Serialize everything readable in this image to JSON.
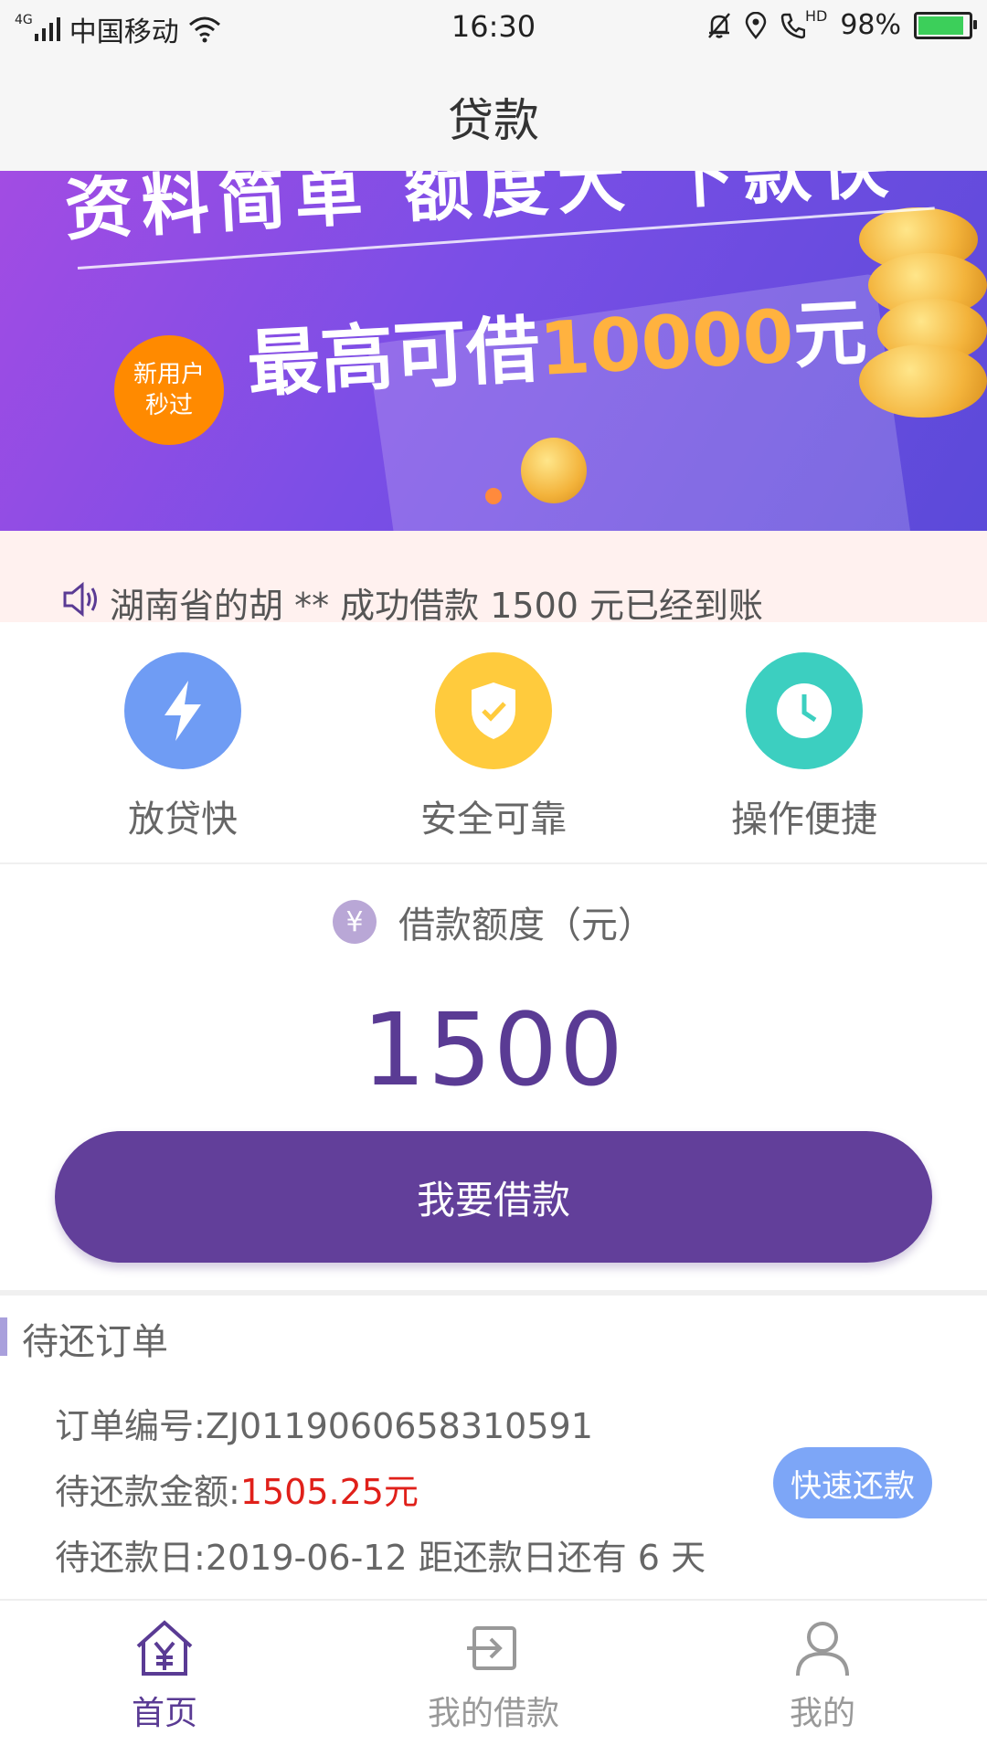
{
  "status_bar": {
    "network": "4G",
    "carrier": "中国移动",
    "time": "16:30",
    "hd": "HD",
    "battery": "98%",
    "battery_level": 0.98
  },
  "nav": {
    "title": "贷款"
  },
  "banner": {
    "headline": "资料简单 额度大 下款快",
    "badge_line1": "新用户",
    "badge_line2": "秒过",
    "main_prefix": "最高可借",
    "main_amount": "10000",
    "main_suffix": "元"
  },
  "notice": {
    "text": "湖南省的胡 ** 成功借款 1500 元已经到账"
  },
  "features": [
    {
      "label": "放贷快",
      "color": "#6f9cf4",
      "icon": "lightning-icon"
    },
    {
      "label": "安全可靠",
      "color": "#ffcb3d",
      "icon": "shield-check-icon"
    },
    {
      "label": "操作便捷",
      "color": "#3ccfc0",
      "icon": "clock-icon"
    }
  ],
  "credit": {
    "icon_symbol": "¥",
    "label": "借款额度（元）",
    "amount": "1500"
  },
  "borrow_button": {
    "label": "我要借款"
  },
  "orders": {
    "section_title": "待还订单",
    "order_no_label": "订单编号:",
    "order_no": "ZJ0119060658310591",
    "amount_label": "待还款金额:",
    "amount": "1505.25元",
    "due_label": "待还款日:",
    "due_text": "2019-06-12 距还款日还有 6 天",
    "repay_button": "快速还款"
  },
  "tabbar": {
    "items": [
      {
        "label": "首页",
        "icon": "home-yen-icon",
        "active": true
      },
      {
        "label": "我的借款",
        "icon": "loan-icon",
        "active": false
      },
      {
        "label": "我的",
        "icon": "user-icon",
        "active": false
      }
    ],
    "active_color": "#5a3b94",
    "inactive_color": "#999999"
  }
}
